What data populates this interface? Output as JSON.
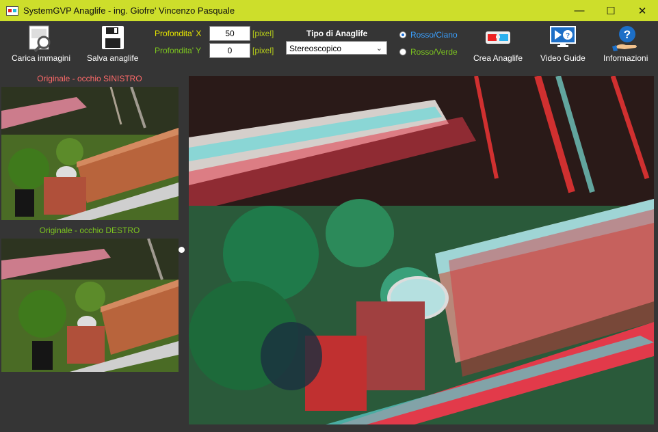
{
  "window": {
    "title": "SystemGVP Anaglife - ing. Giofre' Vincenzo Pasquale",
    "controls": {
      "minimize": "—",
      "maximize": "☐",
      "close": "✕"
    }
  },
  "toolbar": {
    "load_label": "Carica immagini",
    "save_label": "Salva anaglife",
    "create_label": "Crea Anaglife",
    "video_label": "Video Guide",
    "info_label": "Informazioni"
  },
  "depth": {
    "x_label": "Profondita' X",
    "x_value": "50",
    "y_label": "Profondita' Y",
    "y_value": "0",
    "unit": "[pixel]"
  },
  "anaglyph_type": {
    "title": "Tipo di Anaglife",
    "selected": "Stereoscopico"
  },
  "color_mode": {
    "options": [
      {
        "label": "Rosso/Ciano",
        "selected": true
      },
      {
        "label": "Rosso/Verde",
        "selected": false
      }
    ]
  },
  "panels": {
    "left_label": "Originale - occhio SINISTRO",
    "right_label": "Originale - occhio DESTRO"
  },
  "icons": {
    "load": "image-search-icon",
    "save": "floppy-disk-icon",
    "create": "3d-glasses-icon",
    "video": "video-help-icon",
    "info": "help-hand-icon"
  },
  "colors": {
    "titlebar": "#cdde2b",
    "background": "#353535",
    "label_yellow": "#e6e600",
    "label_green": "#7cc41f",
    "left_eye_label": "#ff6a6a",
    "right_eye_label": "#7cc41f",
    "radio_selected": "#3aa0ff"
  }
}
